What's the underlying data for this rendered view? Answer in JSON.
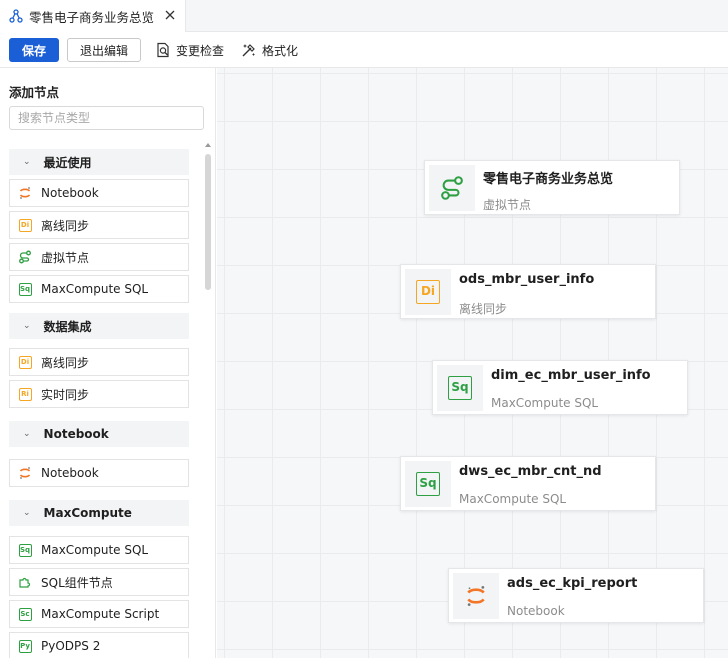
{
  "tab": {
    "title": "零售电子商务业务总览"
  },
  "toolbar": {
    "save_label": "保存",
    "exit_label": "退出编辑",
    "check_label": "变更检查",
    "format_label": "格式化"
  },
  "sidebar": {
    "title": "添加节点",
    "search_placeholder": "搜索节点类型",
    "groups": [
      {
        "label": "最近使用",
        "items": [
          {
            "label": "Notebook",
            "icon": "notebook-icon"
          },
          {
            "label": "离线同步",
            "icon": "di-icon"
          },
          {
            "label": "虚拟节点",
            "icon": "virtual-node-icon"
          },
          {
            "label": "MaxCompute SQL",
            "icon": "sq-icon"
          }
        ]
      },
      {
        "label": "数据集成",
        "items": [
          {
            "label": "离线同步",
            "icon": "di-icon"
          },
          {
            "label": "实时同步",
            "icon": "ri-icon"
          }
        ]
      },
      {
        "label": "Notebook",
        "items": [
          {
            "label": "Notebook",
            "icon": "notebook-icon"
          }
        ]
      },
      {
        "label": "MaxCompute",
        "items": [
          {
            "label": "MaxCompute SQL",
            "icon": "sq-icon"
          },
          {
            "label": "SQL组件节点",
            "icon": "sql-component-icon"
          },
          {
            "label": "MaxCompute Script",
            "icon": "sc-icon"
          },
          {
            "label": "PyODPS 2",
            "icon": "pyodps-icon"
          }
        ]
      }
    ]
  },
  "icon_text": {
    "di": "Di",
    "sq": "Sq",
    "ri": "Ri",
    "sc": "Sc",
    "py": "Py"
  },
  "nodes": [
    {
      "title": "零售电子商务业务总览",
      "subtitle": "虚拟节点",
      "icon": "virtual-node-icon"
    },
    {
      "title": "ods_mbr_user_info",
      "subtitle": "离线同步",
      "icon": "di-icon"
    },
    {
      "title": "dim_ec_mbr_user_info",
      "subtitle": "MaxCompute SQL",
      "icon": "sq-icon"
    },
    {
      "title": "dws_ec_mbr_cnt_nd",
      "subtitle": "MaxCompute SQL",
      "icon": "sq-icon"
    },
    {
      "title": "ads_ec_kpi_report",
      "subtitle": "Notebook",
      "icon": "notebook-icon"
    }
  ],
  "colors": {
    "primary": "#1b5fd6",
    "green": "#2ea043",
    "orange": "#f5a623",
    "notebook_orange": "#f37626"
  }
}
